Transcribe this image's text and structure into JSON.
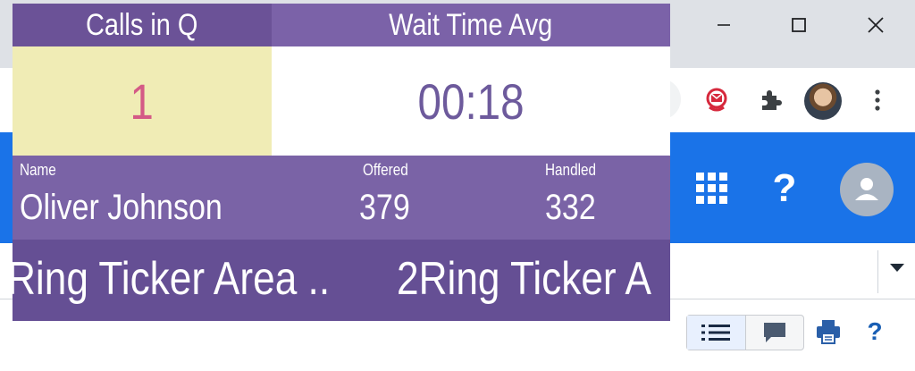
{
  "window_controls": {
    "minimize": "minimize-icon",
    "maximize": "maximize-icon",
    "close": "close-icon"
  },
  "browser_toolbar": {
    "extensions": [
      "mail-extension-icon",
      "puzzle-extension-icon"
    ],
    "profile": "profile-avatar",
    "menu": "kebab-menu-icon"
  },
  "app_header": {
    "apps_icon": "apps-grid-icon",
    "help_label": "?",
    "account_icon": "account-circle-icon",
    "color": "#1a73e8"
  },
  "bottom_toolbar": {
    "help_label": "?"
  },
  "wallboard": {
    "calls_in_q_label": "Calls in Q",
    "wait_time_avg_label": "Wait Time Avg",
    "calls_in_q_value": "1",
    "wait_time_avg_value": "00:18",
    "agent": {
      "name_label": "Name",
      "offered_label": "Offered",
      "handled_label": "Handled",
      "name": "Oliver Johnson",
      "offered": "379",
      "handled": "332"
    },
    "ticker": {
      "text_left": "Ring Ticker Area ..",
      "text_right": "2Ring Ticker A"
    },
    "colors": {
      "header_left": "#6b5297",
      "header_right": "#7b62a8",
      "calls_bg": "#f0ecb5",
      "calls_text": "#d45a86",
      "wait_text": "#6d5a9c",
      "agent_bg": "#7a63a6",
      "ticker_bg": "#654f94"
    }
  }
}
